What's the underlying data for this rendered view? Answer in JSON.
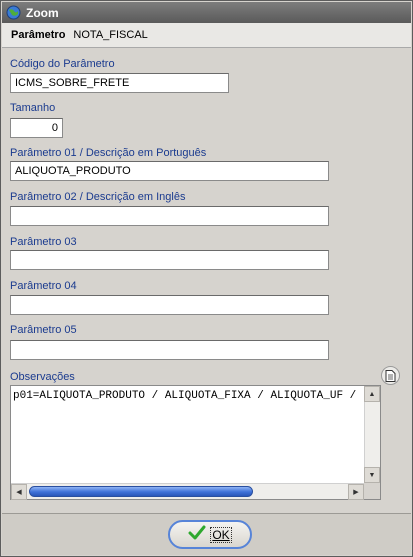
{
  "window": {
    "title": "Zoom"
  },
  "header": {
    "label": "Parâmetro",
    "value": "NOTA_FISCAL"
  },
  "fields": {
    "codigo": {
      "label": "Código do Parâmetro",
      "value": "ICMS_SOBRE_FRETE"
    },
    "tamanho": {
      "label": "Tamanho",
      "value": "0"
    },
    "param01": {
      "label": "Parâmetro 01 / Descrição em Português",
      "value": "ALIQUOTA_PRODUTO"
    },
    "param02": {
      "label": "Parâmetro 02 / Descrição em Inglês",
      "value": ""
    },
    "param03": {
      "label": "Parâmetro 03",
      "value": ""
    },
    "param04": {
      "label": "Parâmetro 04",
      "value": ""
    },
    "param05": {
      "label": "Parâmetro 05",
      "value": ""
    }
  },
  "observacoes": {
    "label": "Observações",
    "text": "p01=ALIQUOTA_PRODUTO / ALIQUOTA_FIXA / ALIQUOTA_UF /",
    "scroll_position": 0.0
  },
  "footer": {
    "ok_label": "OK"
  },
  "icons": {
    "app": "globe-icon",
    "notes": "document-icon",
    "ok": "checkmark-icon"
  },
  "colors": {
    "label_blue": "#1b3b8f",
    "titlebar": "#5a5a5a",
    "ok_check": "#2ea82e",
    "scroll_thumb": "#3f71d8"
  }
}
